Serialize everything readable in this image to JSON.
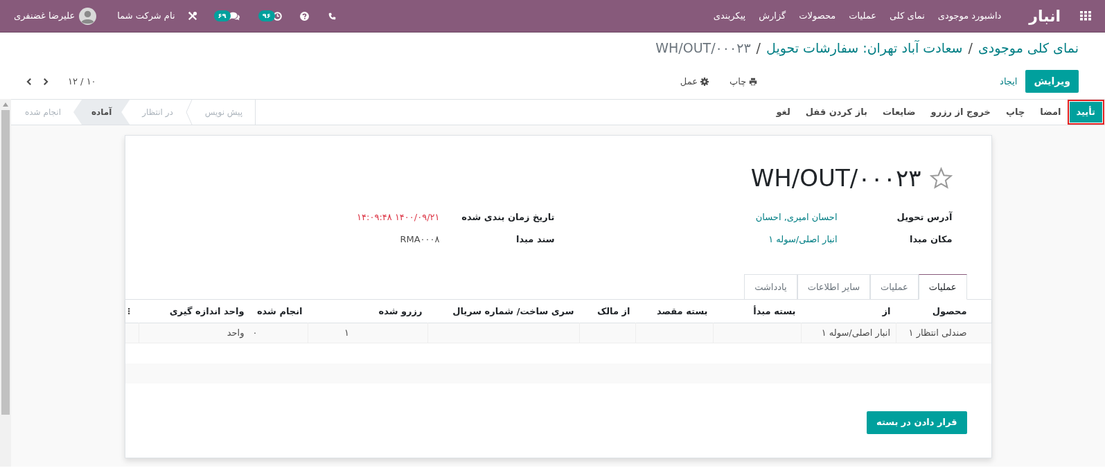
{
  "navbar": {
    "app_title": "انبار",
    "menu": [
      "داشبورد موجودی",
      "نمای کلی",
      "عملیات",
      "محصولات",
      "گزارش",
      "پیکربندی"
    ],
    "activity_count": "۹۶",
    "message_count": "۶۹",
    "company": "نام شرکت شما",
    "user": "علیرضا غضنفری"
  },
  "breadcrumb": {
    "separator": "/",
    "items": [
      {
        "label": "نمای کلی موجودی",
        "kind": "link"
      },
      {
        "label": "سعادت آباد تهران: سفارشات تحویل",
        "kind": "link"
      },
      {
        "label": "WH/OUT/۰۰۰۲۳",
        "kind": "current"
      }
    ]
  },
  "control_panel": {
    "edit_button": "ویرایش",
    "create_button": "ایجاد",
    "print_menu": "چاپ",
    "action_menu": "عمل",
    "pager": "۱۰ / ۱۲"
  },
  "status_actions": [
    {
      "label": "تأیید",
      "kind": "primary",
      "highlighted": true
    },
    {
      "label": "امضا",
      "kind": "secondary",
      "highlighted": false
    },
    {
      "label": "چاپ",
      "kind": "secondary",
      "highlighted": false
    },
    {
      "label": "خروج از رزرو",
      "kind": "secondary",
      "highlighted": false
    },
    {
      "label": "ضایعات",
      "kind": "secondary",
      "highlighted": false
    },
    {
      "label": "باز کردن قفل",
      "kind": "secondary",
      "highlighted": false
    },
    {
      "label": "لغو",
      "kind": "secondary",
      "highlighted": false
    }
  ],
  "stages": [
    {
      "label": "پیش نویس",
      "selected": false
    },
    {
      "label": "در انتظار",
      "selected": false
    },
    {
      "label": "آماده",
      "selected": true
    },
    {
      "label": "انجام شده",
      "selected": false
    }
  ],
  "sheet": {
    "title": "WH/OUT/۰۰۰۲۳",
    "starred": false,
    "field_groups": [
      [
        {
          "label": "آدرس تحویل",
          "value": "احسان امیری, احسان",
          "kind": "link"
        },
        {
          "label": "مکان مبدا",
          "value": "انبار اصلی/سوله ۱",
          "kind": "link"
        }
      ],
      [
        {
          "label": "تاریخ زمان بندی شده",
          "value": "۱۴۰۰/۰۹/۲۱ ۱۴:۰۹:۴۸",
          "kind": "overdue"
        },
        {
          "label": "سند مبدا",
          "value": "RMA۰۰۰۸",
          "kind": "text"
        }
      ]
    ],
    "tabs": [
      {
        "label": "عملیات",
        "selected": true
      },
      {
        "label": "عملیات",
        "selected": false
      },
      {
        "label": "سایر اطلاعات",
        "selected": false
      },
      {
        "label": "یادداشت",
        "selected": false
      }
    ],
    "table": {
      "columns": [
        "محصول",
        "از",
        "بسته مبدأ",
        "بسته مقصد",
        "از مالک",
        "سری ساخت/ شماره سریال",
        "رزرو شده",
        "انجام شده",
        "واحد اندازه گیری"
      ],
      "rows": [
        {
          "product": "صندلی انتظار ۱",
          "location": "انبار اصلی/سوله ۱",
          "reserved": "۱",
          "done": "۰",
          "uom": "واحد"
        }
      ]
    },
    "put_in_pack_button": "قرار دادن در بسته"
  }
}
